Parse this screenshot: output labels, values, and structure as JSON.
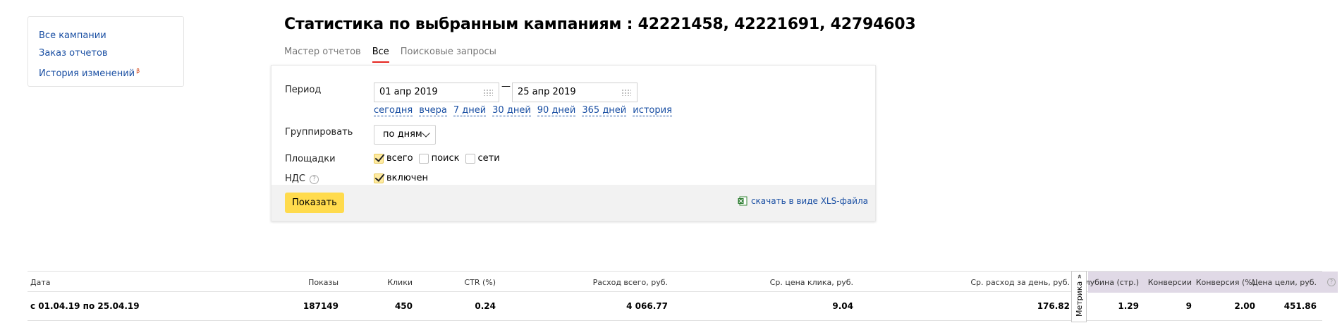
{
  "nav": {
    "links": [
      "Все кампании",
      "Заказ отчетов",
      "История изменений"
    ],
    "history_badge": "β"
  },
  "page": {
    "title": "Статистика по выбранным кампаниям : 42221458, 42221691, 42794603"
  },
  "tabs": [
    {
      "label": "Мастер отчетов",
      "active": false
    },
    {
      "label": "Все",
      "active": true
    },
    {
      "label": "Поисковые запросы",
      "active": false
    }
  ],
  "form": {
    "period_label": "Период",
    "date_from": "01 апр 2019",
    "date_to": "25 апр 2019",
    "dash": "—",
    "quick_links": [
      "сегодня",
      "вчера",
      "7 дней",
      "30 дней",
      "90 дней",
      "365 дней",
      "история"
    ],
    "group_label": "Группировать",
    "group_value": "по дням",
    "platforms_label": "Площадки",
    "platforms": [
      {
        "label": "всего",
        "checked": true
      },
      {
        "label": "поиск",
        "checked": false
      },
      {
        "label": "сети",
        "checked": false
      }
    ],
    "vat_label": "НДС",
    "vat_help": "?",
    "vat_option": {
      "label": "включен",
      "checked": true
    },
    "show_button": "Показать",
    "xls_link": "скачать в виде XLS-файла"
  },
  "table": {
    "headers": [
      "Дата",
      "Показы",
      "Клики",
      "CTR (%)",
      "Расход всего, руб.",
      "Ср. цена клика, руб.",
      "Ср. расход за день, руб.",
      "Глубина (стр.)",
      "Конверсии",
      "Конверсия (%)",
      "Цена цели, руб."
    ],
    "row": [
      "с 01.04.19 по 25.04.19",
      "187149",
      "450",
      "0.24",
      "4 066.77",
      "9.04",
      "176.82",
      "1.29",
      "9",
      "2.00",
      "451.86"
    ],
    "metrika_tab": "Метрика »",
    "help": "?"
  },
  "colors": {
    "link": "#1a4fa3",
    "accent_button": "#ffdb4d",
    "active_tab_underline": "#e52620",
    "metrika_header_bg": "#e0d9e6"
  }
}
